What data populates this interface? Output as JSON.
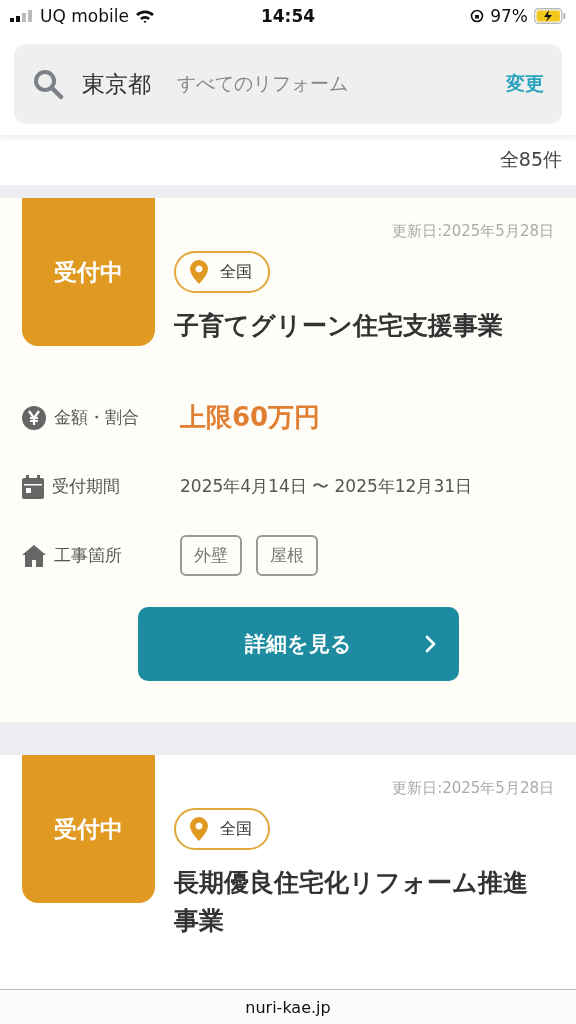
{
  "status_bar": {
    "carrier": "UQ mobile",
    "time": "14:54",
    "battery": "97%"
  },
  "search": {
    "area": "東京都",
    "category": "すべてのリフォーム",
    "change": "変更"
  },
  "result_count": "全85件",
  "cards": [
    {
      "status": "受付中",
      "color": "#fffdf7",
      "updated": "更新日:2025年5月28日",
      "region": "全国",
      "title": "子育てグリーン住宅支援事業",
      "details": [
        {
          "kind": "amount",
          "label": "金額・割合",
          "value": "上限60万円"
        },
        {
          "kind": "period",
          "label": "受付期間",
          "value": "2025年4月14日 〜 2025年12月31日"
        },
        {
          "kind": "parts",
          "label": "工事箇所",
          "tags": [
            "外壁",
            "屋根"
          ]
        }
      ],
      "button": "詳細を見る"
    },
    {
      "status": "受付中",
      "color": "#ffffff",
      "updated": "更新日:2025年5月28日",
      "region": "全国",
      "title": "長期優良住宅化リフォーム推進事業"
    }
  ],
  "url": "nuri-kae.jp"
}
